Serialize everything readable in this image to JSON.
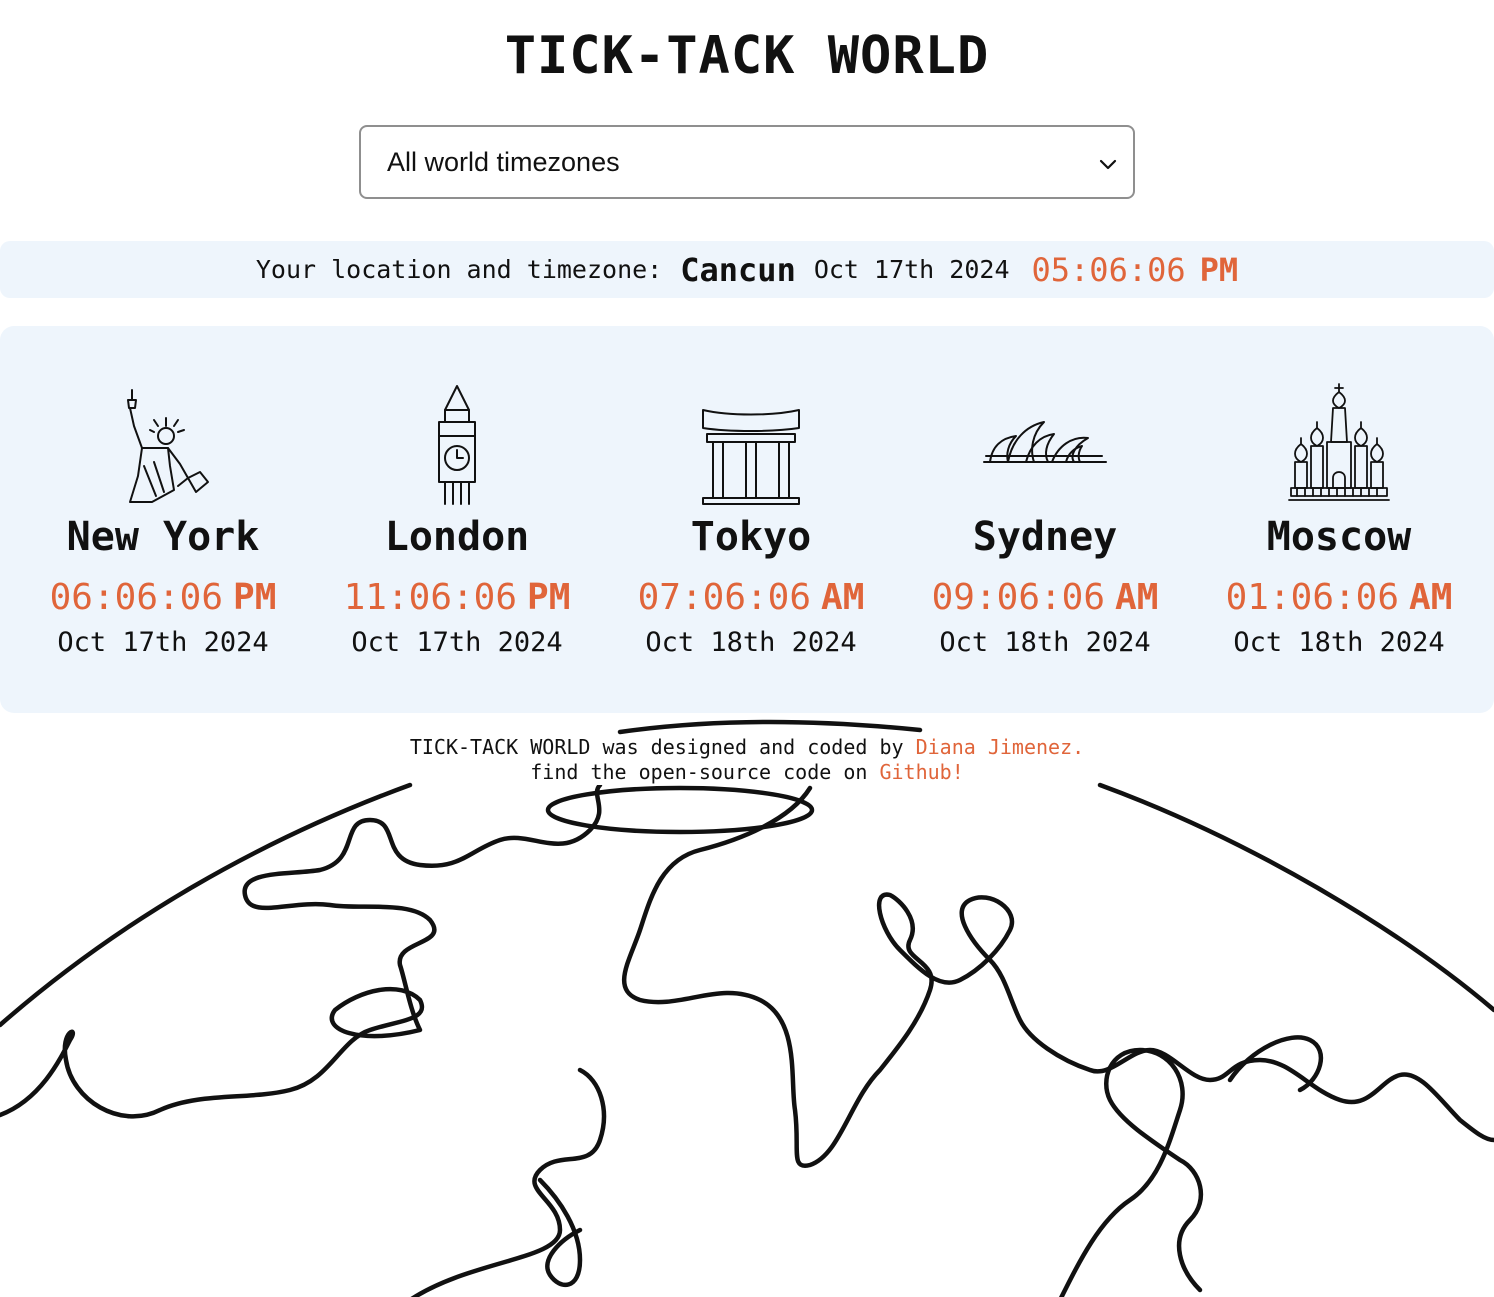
{
  "title": "TICK-TACK WORLD",
  "timezone_select": {
    "selected": "All world timezones"
  },
  "location": {
    "label": "Your location and timezone:",
    "city": "Cancun",
    "date": "Oct 17th 2024",
    "time": "05:06:06",
    "ampm": "PM"
  },
  "cities": [
    {
      "name": "New York",
      "time": "06:06:06",
      "ampm": "PM",
      "date": "Oct 17th 2024",
      "icon": "statue-of-liberty-icon"
    },
    {
      "name": "London",
      "time": "11:06:06",
      "ampm": "PM",
      "date": "Oct 17th 2024",
      "icon": "big-ben-icon"
    },
    {
      "name": "Tokyo",
      "time": "07:06:06",
      "ampm": "AM",
      "date": "Oct 18th 2024",
      "icon": "torii-gate-icon"
    },
    {
      "name": "Sydney",
      "time": "09:06:06",
      "ampm": "AM",
      "date": "Oct 18th 2024",
      "icon": "opera-house-icon"
    },
    {
      "name": "Moscow",
      "time": "01:06:06",
      "ampm": "AM",
      "date": "Oct 18th 2024",
      "icon": "saint-basils-cathedral-icon"
    }
  ],
  "footer": {
    "line1_text": "TICK-TACK WORLD was designed and coded by",
    "author_link": "Diana Jimenez.",
    "line2_text": "find the open-source code on",
    "github_link": "Github!"
  },
  "colors": {
    "accent": "#e0653a",
    "panel_bg": "#eef5fc",
    "text": "#111111"
  }
}
